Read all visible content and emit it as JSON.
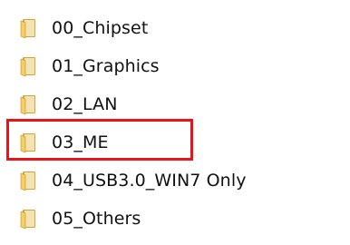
{
  "folders": [
    {
      "name": "00_Chipset"
    },
    {
      "name": "01_Graphics"
    },
    {
      "name": "02_LAN"
    },
    {
      "name": "03_ME"
    },
    {
      "name": "04_USB3.0_WIN7 Only"
    },
    {
      "name": "05_Others"
    }
  ],
  "highlight": {
    "target": "03_ME",
    "color": "#e8141a"
  },
  "icon": {
    "name": "folder-icon",
    "colors": {
      "back": "#d9a53a",
      "front": "#f6cf63",
      "shade": "#c48f28"
    }
  }
}
